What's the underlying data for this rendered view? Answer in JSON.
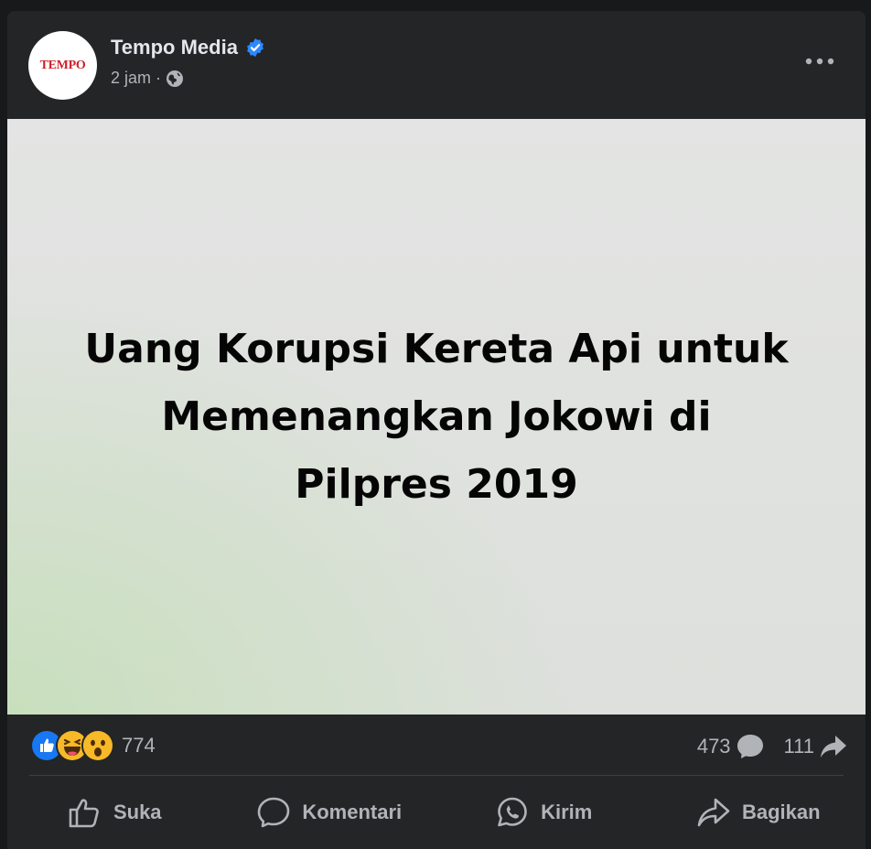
{
  "post": {
    "page_name": "Tempo Media",
    "avatar_text": "TEMPO",
    "time": "2 jam",
    "separator": "·",
    "verified": true,
    "privacy_icon": "globe-icon"
  },
  "image": {
    "headline_line1": "Uang Korupsi Kereta Api untuk",
    "headline_line2": "Memenangkan Jokowi di",
    "headline_line3": "Pilpres 2019"
  },
  "stats": {
    "reactions": [
      "like-icon",
      "haha-icon",
      "wow-icon"
    ],
    "reaction_count": "774",
    "comment_count": "473",
    "share_count": "111"
  },
  "actions": {
    "like": "Suka",
    "comment": "Komentari",
    "send": "Kirim",
    "share": "Bagikan"
  },
  "colors": {
    "background": "#242526",
    "text_primary": "#e4e6eb",
    "text_secondary": "#b0b3b8",
    "verified_blue": "#2d88ff",
    "brand_red": "#d0202c"
  }
}
